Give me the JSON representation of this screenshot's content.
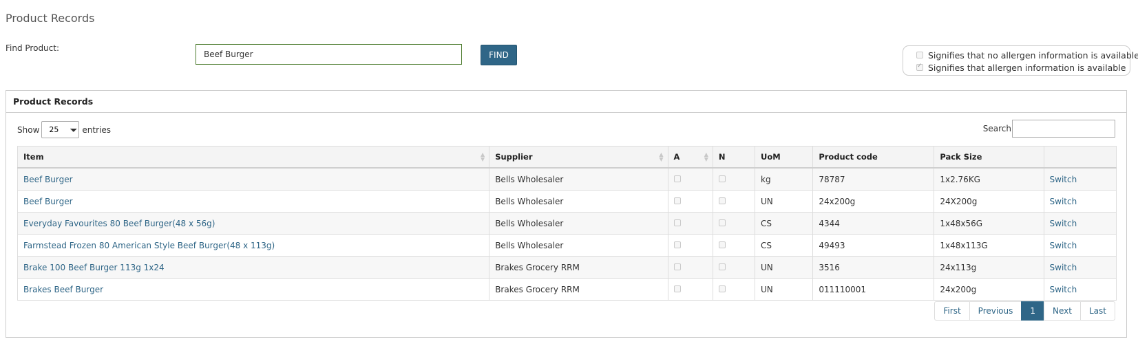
{
  "page": {
    "title": "Product Records"
  },
  "find": {
    "label": "Find Product:",
    "value": "Beef Burger",
    "button_label": "FIND"
  },
  "legend": {
    "no_allergen_text": "Signifies that no allergen information is available",
    "allergen_text": "Signifies that allergen information is available"
  },
  "panel": {
    "title": "Product Records"
  },
  "table_controls": {
    "show_label": "Show",
    "entries_value": "25",
    "entries_label": "entries",
    "search_label": "Search",
    "search_value": ""
  },
  "table": {
    "headers": [
      "Item",
      "Supplier",
      "A",
      "N",
      "UoM",
      "Product code",
      "Pack Size",
      ""
    ],
    "rows": [
      {
        "item": "Beef Burger",
        "supplier": "Bells Wholesaler",
        "a": false,
        "n": false,
        "uom": "kg",
        "code": "78787",
        "pack": "1x2.76KG",
        "action": "Switch"
      },
      {
        "item": "Beef Burger",
        "supplier": "Bells Wholesaler",
        "a": false,
        "n": false,
        "uom": "UN",
        "code": "24x200g",
        "pack": "24X200g",
        "action": "Switch"
      },
      {
        "item": "Everyday Favourites 80 Beef Burger(48 x 56g)",
        "supplier": "Bells Wholesaler",
        "a": false,
        "n": false,
        "uom": "CS",
        "code": "4344",
        "pack": "1x48x56G",
        "action": "Switch"
      },
      {
        "item": "Farmstead Frozen 80 American Style Beef Burger(48 x 113g)",
        "supplier": "Bells Wholesaler",
        "a": false,
        "n": false,
        "uom": "CS",
        "code": "49493",
        "pack": "1x48x113G",
        "action": "Switch"
      },
      {
        "item": "Brake 100 Beef Burger 113g 1x24",
        "supplier": "Brakes Grocery RRM",
        "a": false,
        "n": false,
        "uom": "UN",
        "code": "3516",
        "pack": "24x113g",
        "action": "Switch"
      },
      {
        "item": "Brakes Beef Burger",
        "supplier": "Brakes Grocery RRM",
        "a": false,
        "n": false,
        "uom": "UN",
        "code": "011110001",
        "pack": "24x200g",
        "action": "Switch"
      }
    ]
  },
  "pagination": {
    "first": "First",
    "previous": "Previous",
    "current": "1",
    "next": "Next",
    "last": "Last"
  },
  "colors": {
    "accent": "#2f6687",
    "input_border": "#4a7a2c"
  }
}
